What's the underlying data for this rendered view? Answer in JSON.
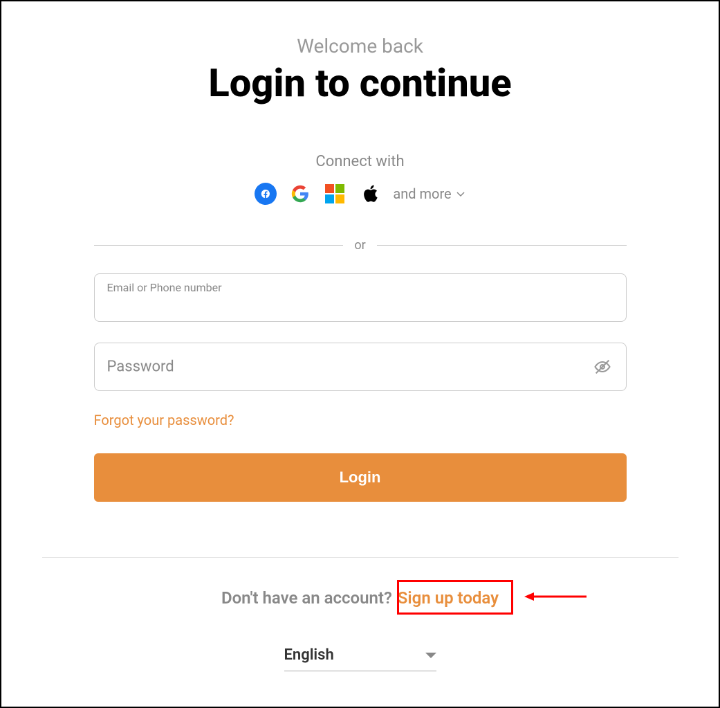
{
  "header": {
    "welcome": "Welcome back",
    "title": "Login to continue"
  },
  "social": {
    "connect_label": "Connect with",
    "more_label": "and more"
  },
  "divider": {
    "or": "or"
  },
  "form": {
    "email_label": "Email or Phone number",
    "password_placeholder": "Password",
    "forgot_label": "Forgot your password?",
    "login_button": "Login"
  },
  "signup": {
    "prompt": "Don't have an account?",
    "link": "Sign up today"
  },
  "language": {
    "selected": "English"
  }
}
